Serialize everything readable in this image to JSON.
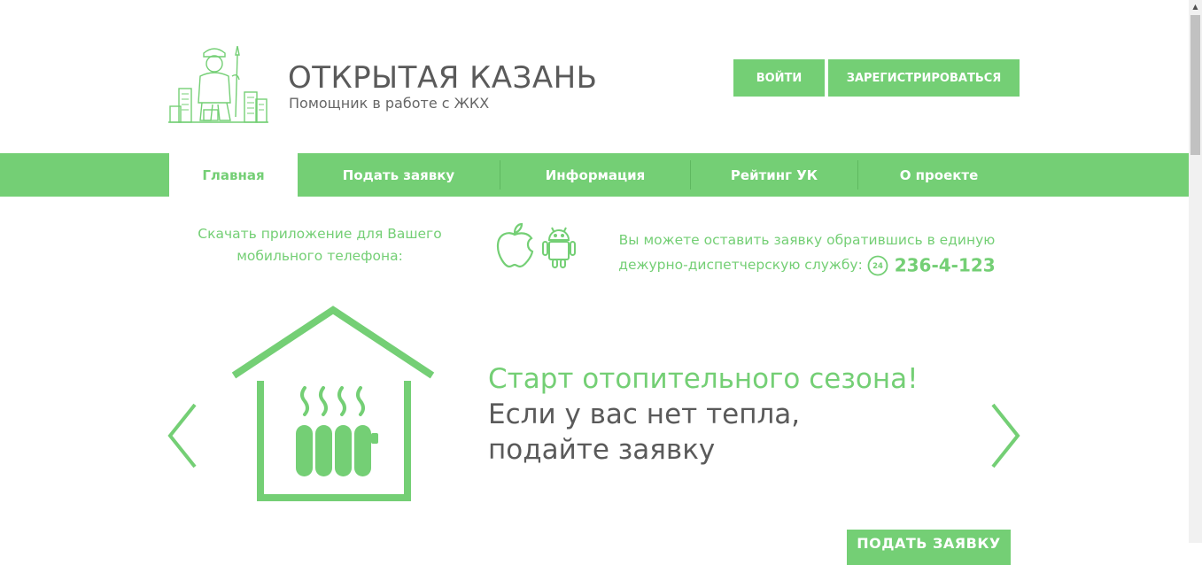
{
  "brand": {
    "title": "ОТКРЫТАЯ КАЗАНЬ",
    "subtitle": "Помощник в работе с ЖКХ",
    "logo_icon": "plumber-city-logo"
  },
  "auth": {
    "login_label": "ВОЙТИ",
    "register_label": "ЗАРЕГИСТРИРОВАТЬСЯ"
  },
  "nav": {
    "items": [
      {
        "label": "Главная",
        "active": true
      },
      {
        "label": "Подать заявку",
        "active": false
      },
      {
        "label": "Информация",
        "active": false
      },
      {
        "label": "Рейтинг УК",
        "active": false
      },
      {
        "label": "О проекте",
        "active": false
      }
    ]
  },
  "apps": {
    "download_text": "Скачать приложение для Вашего мобильного телефона:",
    "ios_icon": "apple-icon",
    "android_icon": "android-icon"
  },
  "dispatch": {
    "text_line1": "Вы можете оставить заявку обратившись в единую",
    "text_line2": "дежурно-диспетчерскую службу:",
    "phone": "236-4-123",
    "phone_icon": "phone-24-icon"
  },
  "slide": {
    "headline": "Старт отопительного сезона!",
    "line1": "Если у вас нет тепла,",
    "line2": "подайте заявку",
    "cta_label": "ПОДАТЬ ЗАЯВКУ",
    "illustration": "house-heater-icon"
  },
  "colors": {
    "accent": "#74cf75",
    "text_dark": "#5a5a5a",
    "background": "#ffffff"
  }
}
